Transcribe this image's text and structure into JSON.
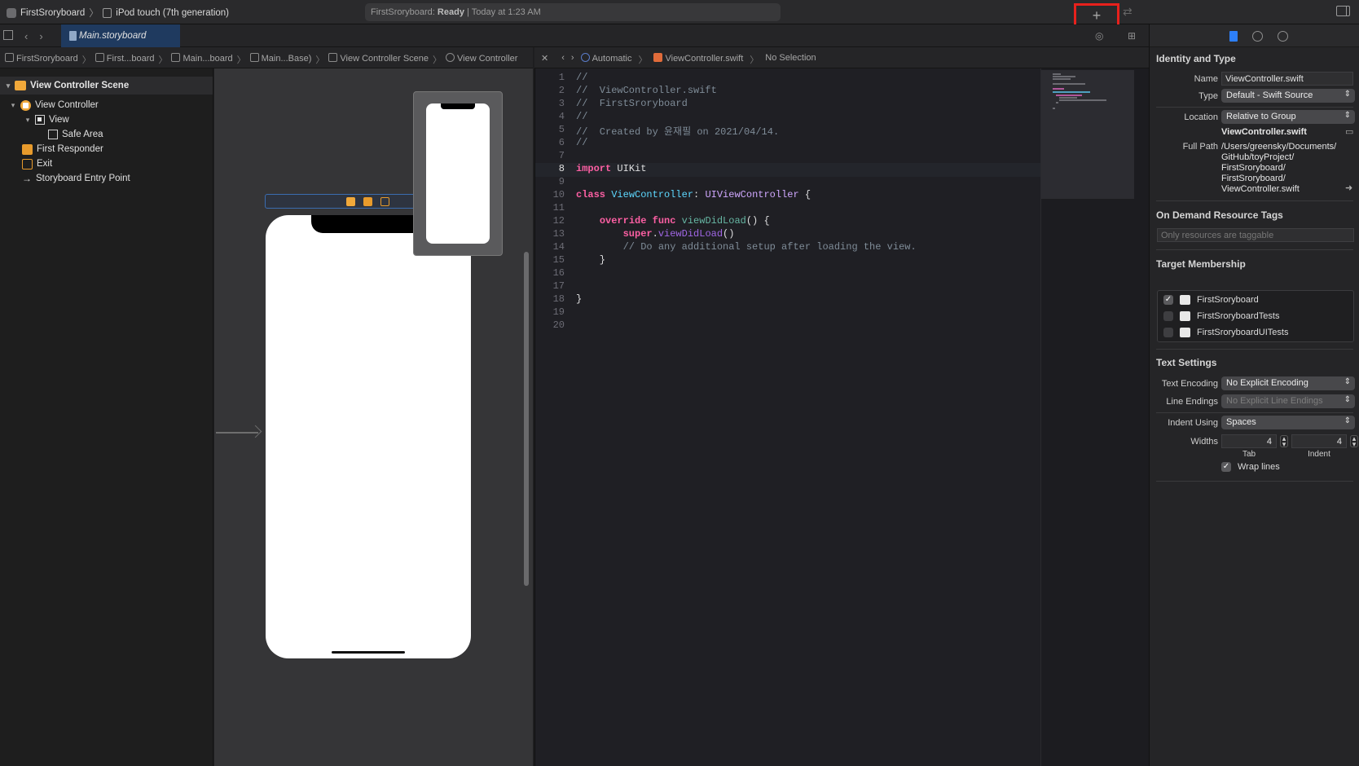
{
  "toolbar": {
    "scheme_name": "FirstSroryboard",
    "device_name": "iPod touch (7th generation)",
    "activity_project": "FirstSroryboard:",
    "activity_status": "Ready",
    "activity_time": "| Today at 1:23 AM",
    "add_label": "+"
  },
  "tabs": {
    "active_tab": "Main.storyboard"
  },
  "jump_bar_left": [
    "FirstSroryboard",
    "First...board",
    "Main...board",
    "Main...Base)",
    "View Controller Scene",
    "View Controller"
  ],
  "jump_bar_right": [
    "Automatic",
    "ViewController.swift",
    "No Selection"
  ],
  "outline": {
    "scene": "View Controller Scene",
    "view_controller": "View Controller",
    "view": "View",
    "safe_area": "Safe Area",
    "first_responder": "First Responder",
    "exit": "Exit",
    "entry_point": "Storyboard Entry Point"
  },
  "editor": {
    "current_line": 8,
    "lines": [
      "//",
      "//  ViewController.swift",
      "//  FirstSroryboard",
      "//",
      "//  Created by 윤재필 on 2021/04/14.",
      "//",
      "",
      "import UIKit",
      "",
      "class ViewController: UIViewController {",
      "",
      "    override func viewDidLoad() {",
      "        super.viewDidLoad()",
      "        // Do any additional setup after loading the view.",
      "    }",
      "",
      "",
      "}",
      "",
      ""
    ]
  },
  "inspector": {
    "identity": {
      "title": "Identity and Type",
      "name_label": "Name",
      "name_value": "ViewController.swift",
      "type_label": "Type",
      "type_value": "Default - Swift Source",
      "location_label": "Location",
      "location_value": "Relative to Group",
      "location_file": "ViewController.swift",
      "full_path_label": "Full Path",
      "full_path_lines": [
        "/Users/greensky/Documents/",
        "GitHub/toyProject/",
        "FirstSroryboard/",
        "FirstSroryboard/",
        "ViewController.swift"
      ]
    },
    "on_demand": {
      "title": "On Demand Resource Tags",
      "placeholder": "Only resources are taggable"
    },
    "target_membership": {
      "title": "Target Membership",
      "targets": [
        {
          "name": "FirstSroryboard",
          "checked": true
        },
        {
          "name": "FirstSroryboardTests",
          "checked": false
        },
        {
          "name": "FirstSroryboardUITests",
          "checked": false
        }
      ]
    },
    "text_settings": {
      "title": "Text Settings",
      "encoding_label": "Text Encoding",
      "encoding_value": "No Explicit Encoding",
      "line_endings_label": "Line Endings",
      "line_endings_value": "No Explicit Line Endings",
      "indent_using_label": "Indent Using",
      "indent_using_value": "Spaces",
      "widths_label": "Widths",
      "tab_width": "4",
      "indent_width": "4",
      "tab_label": "Tab",
      "indent_label": "Indent",
      "wrap_lines_label": "Wrap lines"
    }
  },
  "colors": {
    "accent": "#2d7ff9",
    "highlight_box": "#e8211c",
    "keyword": "#fc5fa3",
    "type": "#5dd8ff",
    "comment": "#7f8c98"
  }
}
